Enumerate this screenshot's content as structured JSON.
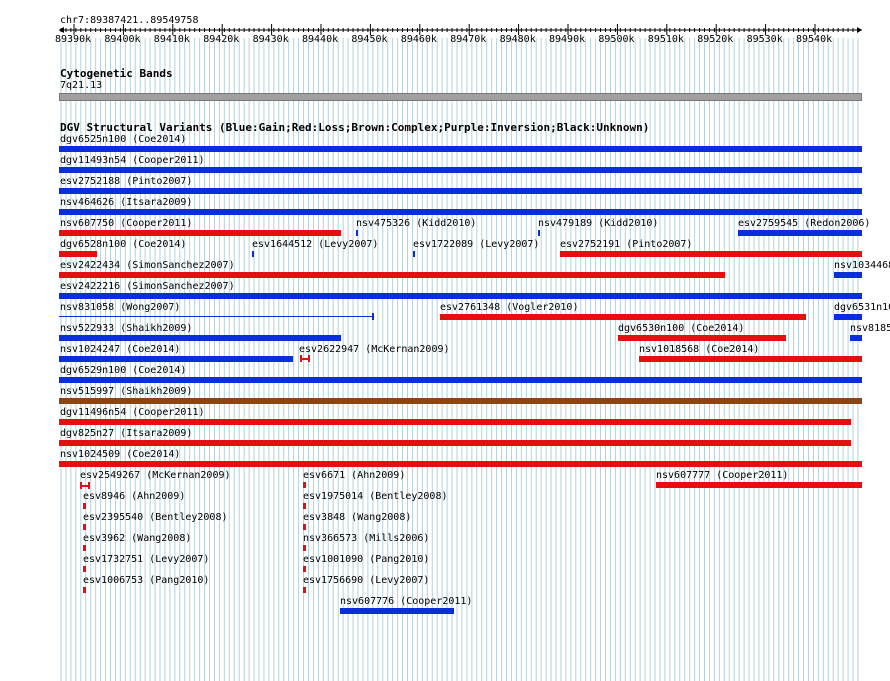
{
  "genome_view": {
    "region_label": "chr7:89387421..89549758",
    "ruler_ticks": [
      "89390k",
      "89400k",
      "89410k",
      "89420k",
      "89430k",
      "89440k",
      "89450k",
      "89460k",
      "89470k",
      "89480k",
      "89490k",
      "89500k",
      "89510k",
      "89520k",
      "89530k",
      "89540k"
    ]
  },
  "tracks": {
    "cytoband": {
      "title": "Cytogenetic Bands",
      "band": "7q21.13"
    },
    "dgv": {
      "title": "DGV Structural Variants (Blue:Gain;Red:Loss;Brown:Complex;Purple:Inversion;Black:Unknown)"
    }
  },
  "colors": {
    "gain": "#0a2edc",
    "loss": "#e60f0f",
    "complex": "#8b4513",
    "grid": "#b4d2dc"
  },
  "features": [
    {
      "label": "dgv6525n100 (Coe2014)",
      "type": "gain"
    },
    {
      "label": "dgv11493n54 (Cooper2011)",
      "type": "gain"
    },
    {
      "label": "esv2752188 (Pinto2007)",
      "type": "gain"
    },
    {
      "label": "nsv464626 (Itsara2009)",
      "type": "gain"
    },
    {
      "label": "nsv607750 (Cooper2011)",
      "type": "loss"
    },
    {
      "label": "nsv475326 (Kidd2010)",
      "type": "gain"
    },
    {
      "label": "nsv479189 (Kidd2010)",
      "type": "gain"
    },
    {
      "label": "esv2759545 (Redon2006)",
      "type": "gain"
    },
    {
      "label": "dgv6528n100 (Coe2014)",
      "type": "loss"
    },
    {
      "label": "esv1644512 (Levy2007)",
      "type": "gain"
    },
    {
      "label": "esv1722089 (Levy2007)",
      "type": "gain"
    },
    {
      "label": "esv2752191 (Pinto2007)",
      "type": "loss"
    },
    {
      "label": "esv2422434 (SimonSanchez2007)",
      "type": "loss"
    },
    {
      "label": "nsv1034468",
      "type": "gain"
    },
    {
      "label": "esv2422216 (SimonSanchez2007)",
      "type": "gain"
    },
    {
      "label": "nsv831058 (Wong2007)",
      "type": "gain"
    },
    {
      "label": "esv2761348 (Vogler2010)",
      "type": "loss"
    },
    {
      "label": "dgv6531n10",
      "type": "gain"
    },
    {
      "label": "nsv522933 (Shaikh2009)",
      "type": "gain"
    },
    {
      "label": "dgv6530n100 (Coe2014)",
      "type": "loss"
    },
    {
      "label": "nsv8185",
      "type": "gain"
    },
    {
      "label": "nsv1024247 (Coe2014)",
      "type": "gain"
    },
    {
      "label": "esv2622947 (McKernan2009)",
      "type": "loss"
    },
    {
      "label": "nsv1018568 (Coe2014)",
      "type": "loss"
    },
    {
      "label": "dgv6529n100 (Coe2014)",
      "type": "gain"
    },
    {
      "label": "nsv515997 (Shaikh2009)",
      "type": "complex"
    },
    {
      "label": "dgv11496n54 (Cooper2011)",
      "type": "loss"
    },
    {
      "label": "dgv825n27 (Itsara2009)",
      "type": "loss"
    },
    {
      "label": "nsv1024509 (Coe2014)",
      "type": "loss"
    },
    {
      "label": "esv2549267 (McKernan2009)",
      "type": "loss"
    },
    {
      "label": "esv6671 (Ahn2009)",
      "type": "loss"
    },
    {
      "label": "nsv607777 (Cooper2011)",
      "type": "loss"
    },
    {
      "label": "esv8946 (Ahn2009)",
      "type": "loss"
    },
    {
      "label": "esv1975014 (Bentley2008)",
      "type": "loss"
    },
    {
      "label": "esv2395540 (Bentley2008)",
      "type": "loss"
    },
    {
      "label": "esv3848 (Wang2008)",
      "type": "loss"
    },
    {
      "label": "esv3962 (Wang2008)",
      "type": "loss"
    },
    {
      "label": "nsv366573 (Mills2006)",
      "type": "loss"
    },
    {
      "label": "esv1732751 (Levy2007)",
      "type": "loss"
    },
    {
      "label": "esv1001090 (Pang2010)",
      "type": "loss"
    },
    {
      "label": "esv1006753 (Pang2010)",
      "type": "loss"
    },
    {
      "label": "esv1756690 (Levy2007)",
      "type": "loss"
    },
    {
      "label": "nsv607776 (Cooper2011)",
      "type": "gain"
    }
  ]
}
